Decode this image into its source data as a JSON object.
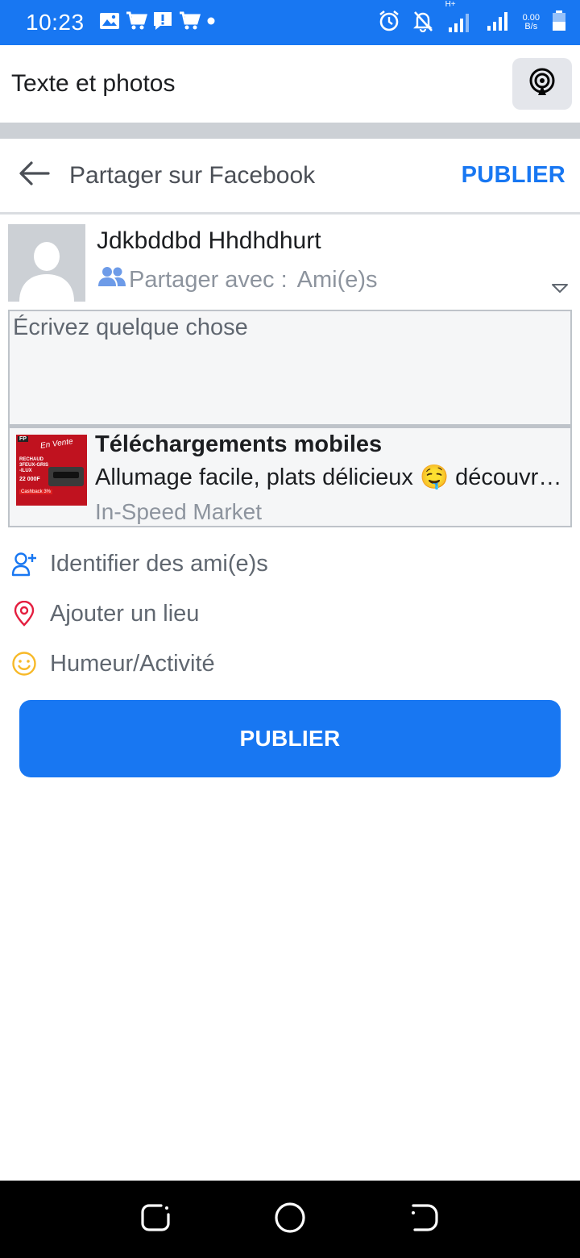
{
  "status_bar": {
    "time": "10:23",
    "network_type": "H+",
    "net_speed_value": "0.00",
    "net_speed_unit": "B/s",
    "left_icons": [
      "image-icon",
      "cart-icon",
      "alert-icon",
      "cart-icon",
      "dot-icon"
    ],
    "right_icons": [
      "alarm-icon",
      "bell-off-icon",
      "signal-icon",
      "signal-icon",
      "battery-icon"
    ]
  },
  "app_header": {
    "title": "Texte et photos",
    "cast_icon": "broadcast-icon"
  },
  "share_header": {
    "back_icon": "arrow-left-icon",
    "title": "Partager sur Facebook",
    "publish_label": "PUBLIER"
  },
  "user": {
    "name": "Jdkbddbd Hhdhdhurt",
    "audience_label": "Partager avec :",
    "audience_value": "Ami(e)s",
    "audience_icon": "friends-icon"
  },
  "composer": {
    "placeholder": "Écrivez quelque chose",
    "value": ""
  },
  "link_preview": {
    "title": "Téléchargements mobiles",
    "description": "Allumage facile, plats délicieux 🤤 découvrez",
    "source": "In-Speed Market",
    "thumbnail": {
      "badge": "FP",
      "brand": "En Vente",
      "product": "RECHAUD 3FEUX-GRIS -ILUX",
      "price": "22 000F",
      "cashback": "Cashback 3%"
    }
  },
  "actions": [
    {
      "label": "Identifier des ami(e)s",
      "icon": "add-friend-icon",
      "color": "#1877f2"
    },
    {
      "label": "Ajouter un lieu",
      "icon": "location-pin-icon",
      "color": "#e41e3f"
    },
    {
      "label": "Humeur/Activité",
      "icon": "smiley-icon",
      "color": "#f7b928"
    }
  ],
  "publish_button": {
    "label": "PUBLIER"
  },
  "colors": {
    "brand": "#1877f2",
    "band": "#ccd0d5"
  },
  "nav_bar": {
    "icons": [
      "recents-icon",
      "home-icon",
      "back-icon"
    ]
  }
}
